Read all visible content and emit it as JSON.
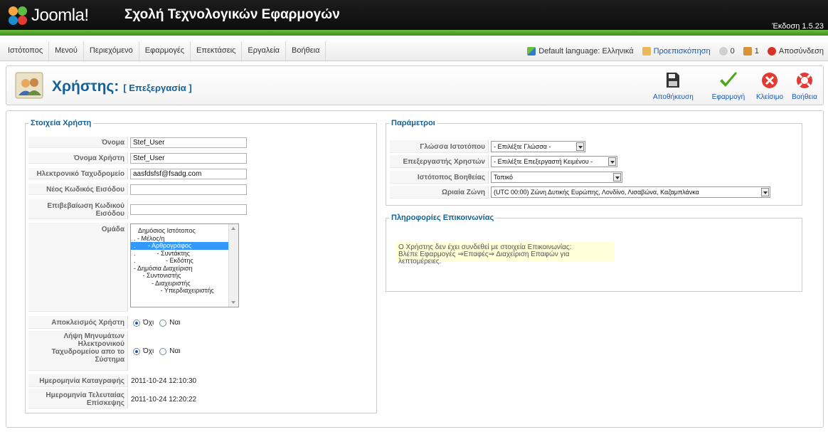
{
  "header": {
    "brand": "Joomla!",
    "site_name": "Σχολή Τεχνολογικών Εφαρμογών",
    "version": "Έκδοση 1.5.23"
  },
  "menu": {
    "items": [
      "Ιστότοπος",
      "Μενού",
      "Περιεχόμενο",
      "Εφαρμογές",
      "Επεκτάσεις",
      "Εργαλεία",
      "Βοήθεια"
    ]
  },
  "status": {
    "language": "Default language: Ελληνικά",
    "preview": "Προεπισκόπηση",
    "messages": "0",
    "users": "1",
    "logout": "Αποσύνδεση"
  },
  "toolbar": {
    "title": "Χρήστης:",
    "subtitle": "[ Επεξεργασία ]",
    "buttons": [
      "Αποθήκευση",
      "Εφαρμογή",
      "Κλείσιμο",
      "Βοήθεια"
    ]
  },
  "user_details": {
    "legend": "Στοιχεία Χρήστη",
    "name_label": "Όνομα",
    "name_value": "Stef_User",
    "username_label": "Όνομα Χρήστη",
    "username_value": "Stef_User",
    "email_label": "Ηλεκτρονικό Ταχυδρομείο",
    "email_value": "aasfdsfsf@fsadg.com",
    "new_password_label": "Νέος Κωδικός Εισόδου",
    "verify_password_label_1": "Επιβεβαίωση Κωδικού",
    "verify_password_label_2": "Εισόδου",
    "group_label": "Ομάδα",
    "groups": [
      "Δημόσιος Ιστότοπος",
      ". - Μέλος/η",
      ".       - Αρθρογράφος",
      ".            - Συντάκτης",
      ".                 - Εκδότης",
      "- Δημόσια Διαχείριση",
      "     - Συντονιστής",
      "          - Διαχειριστής",
      "               - Υπερδιαχειριστής"
    ],
    "block_label": "Αποκλεισμός Χρήστη",
    "receive_label_1": "Λήψη Μηνυμάτων",
    "receive_label_2": "Ηλεκτρονικού",
    "receive_label_3": "Ταχυδρομείου απο το",
    "receive_label_4": "Σύστημα",
    "no": "Όχι",
    "yes": "Ναι",
    "register_date_label": "Ημερομηνία Καταγραφής",
    "register_date": "2011-10-24 12:10:30",
    "last_visit_label_1": "Ημερομηνία Τελευταίας",
    "last_visit_label_2": "Επίσκεψης",
    "last_visit_date": "2011-10-24 12:20:22"
  },
  "parameters": {
    "legend": "Παράμετροι",
    "site_language_label": "Γλώσσα Ιστοτόπου",
    "site_language_value": "- Επιλέξτε Γλώσσα -",
    "editor_label": "Επεξεργαστής Χρηστών",
    "editor_value": "- Επιλέξτε Επεξεργαστή Κειμένου -",
    "help_site_label": "Ιστότοπος Βοηθείας",
    "help_site_value": "Τοπικό",
    "timezone_label": "Ωριαία Ζώνη",
    "timezone_value": "(UTC 00:00) Ζώνη Δυτικής Ευρώπης, Λονδίνο, Λισαβώνα, Καζαμπλάνκα"
  },
  "contact": {
    "legend": "Πληροφορίες Επικοινωνίας",
    "line1": "Ο Χρήστης δεν έχει συνδεθεί με στοιχεία Επικοινωνίας:",
    "line2": "Βλέπε Εφαρμογές ⇒Επαφές⇒ Διαχείριση Επαφών για λεπτομέρειες."
  }
}
